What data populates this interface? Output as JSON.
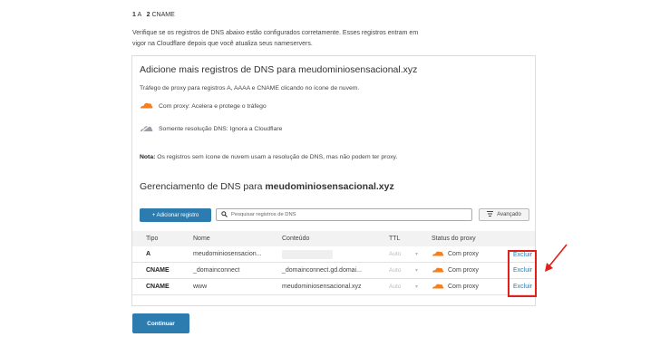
{
  "steps": {
    "step1_num": "1",
    "step1_label": "A",
    "step2_num": "2",
    "step2_label": "CNAME"
  },
  "intro": "Verifique se os registros de DNS abaixo estão configurados corretamente. Esses registros entram em vigor na Cloudflare depois que você atualiza seus nameservers.",
  "card": {
    "title": "Adicione mais registros de DNS para meudominiosensacional.xyz",
    "subtitle": "Tráfego de proxy para registros A, AAAA e CNAME clicando no ícone de nuvem.",
    "legend_proxied": "Com proxy: Acelera e protege o tráfego",
    "legend_dns_only": "Somente resolução DNS: Ignora a Cloudflare",
    "note_label": "Nota:",
    "note_text": " Os registros sem ícone de nuvem usam a resolução de DNS, mas não podem ter proxy.",
    "mgmt_prefix": "Gerenciamento de DNS para ",
    "mgmt_domain": "meudominiosensacional.xyz"
  },
  "toolbar": {
    "add_label": "+ Adicionar registro",
    "search_placeholder": "Pesquisar registros de DNS",
    "advanced_label": "Avançado"
  },
  "table": {
    "headers": {
      "type": "Tipo",
      "name": "Nome",
      "content": "Conteúdo",
      "ttl": "TTL",
      "status": "Status do proxy"
    },
    "rows": [
      {
        "type": "A",
        "name": "meudominiosensacion...",
        "content": "",
        "ttl": "Auto",
        "status": "Com proxy",
        "action": "Excluir"
      },
      {
        "type": "CNAME",
        "name": "_domainconnect",
        "content": "_domainconnect.gd.domai...",
        "ttl": "Auto",
        "status": "Com proxy",
        "action": "Excluir"
      },
      {
        "type": "CNAME",
        "name": "www",
        "content": "meudominiosensacional.xyz",
        "ttl": "Auto",
        "status": "Com proxy",
        "action": "Excluir"
      }
    ]
  },
  "continue_label": "Continuar",
  "colors": {
    "accent": "#2c7cb0",
    "cloud_orange": "#f38020",
    "highlight_red": "#e0201b"
  },
  "icons": [
    "cloud-orange-icon",
    "cloud-gray-icon",
    "search-icon",
    "filter-icon",
    "chevron-down-icon",
    "arrow-annotation-icon"
  ]
}
